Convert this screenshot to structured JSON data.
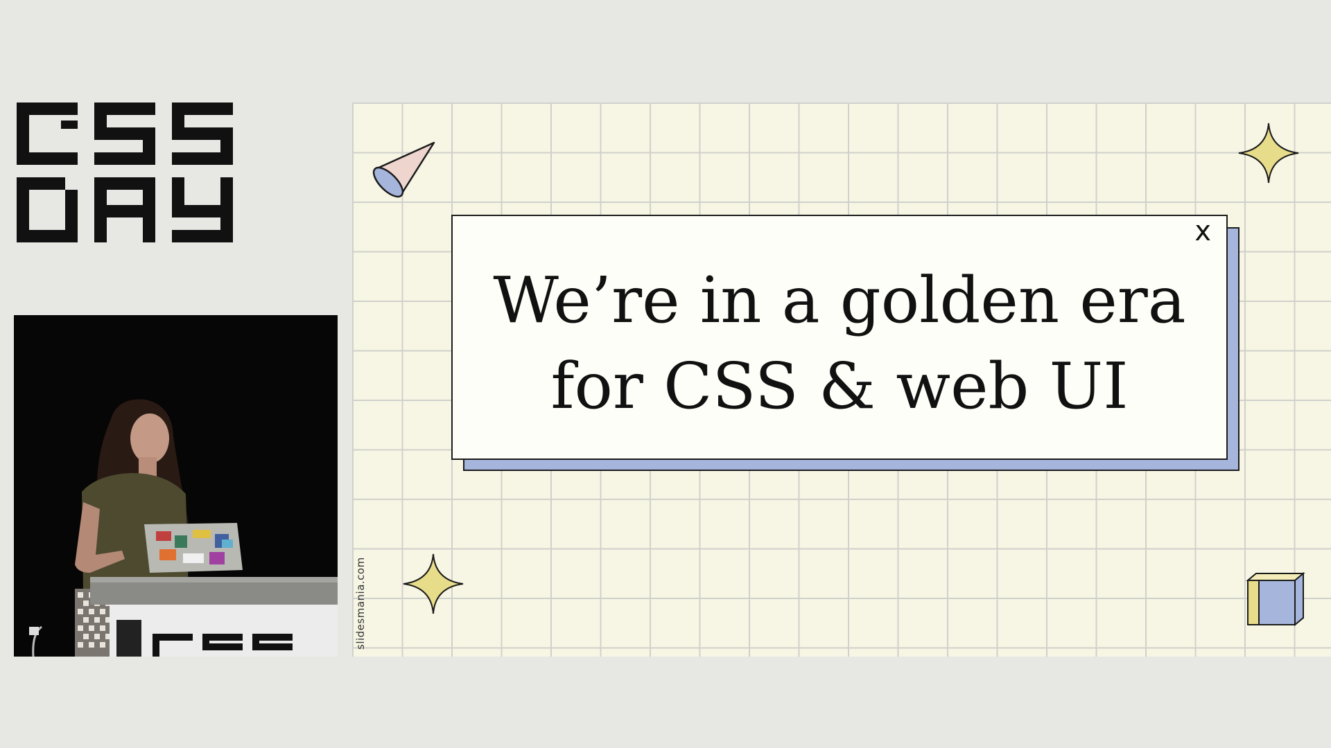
{
  "logo": {
    "text": "CSS DAY",
    "color": "#111111"
  },
  "slide": {
    "headline_line1": "We’re in a golden era",
    "headline_line2": "for CSS & web UI",
    "close_glyph": "x",
    "credit": "slidesmania.com",
    "colors": {
      "background": "#f7f6e4",
      "grid": "#d0d0cc",
      "window": "#fefef8",
      "window_shadow": "#a6b5db",
      "sparkle": "#e7dc8a",
      "cone": "#eed6cf",
      "cube_blue": "#a6b5db",
      "cube_yellow": "#e7dc8a"
    }
  },
  "video": {
    "description_icon": "speaker-video"
  }
}
